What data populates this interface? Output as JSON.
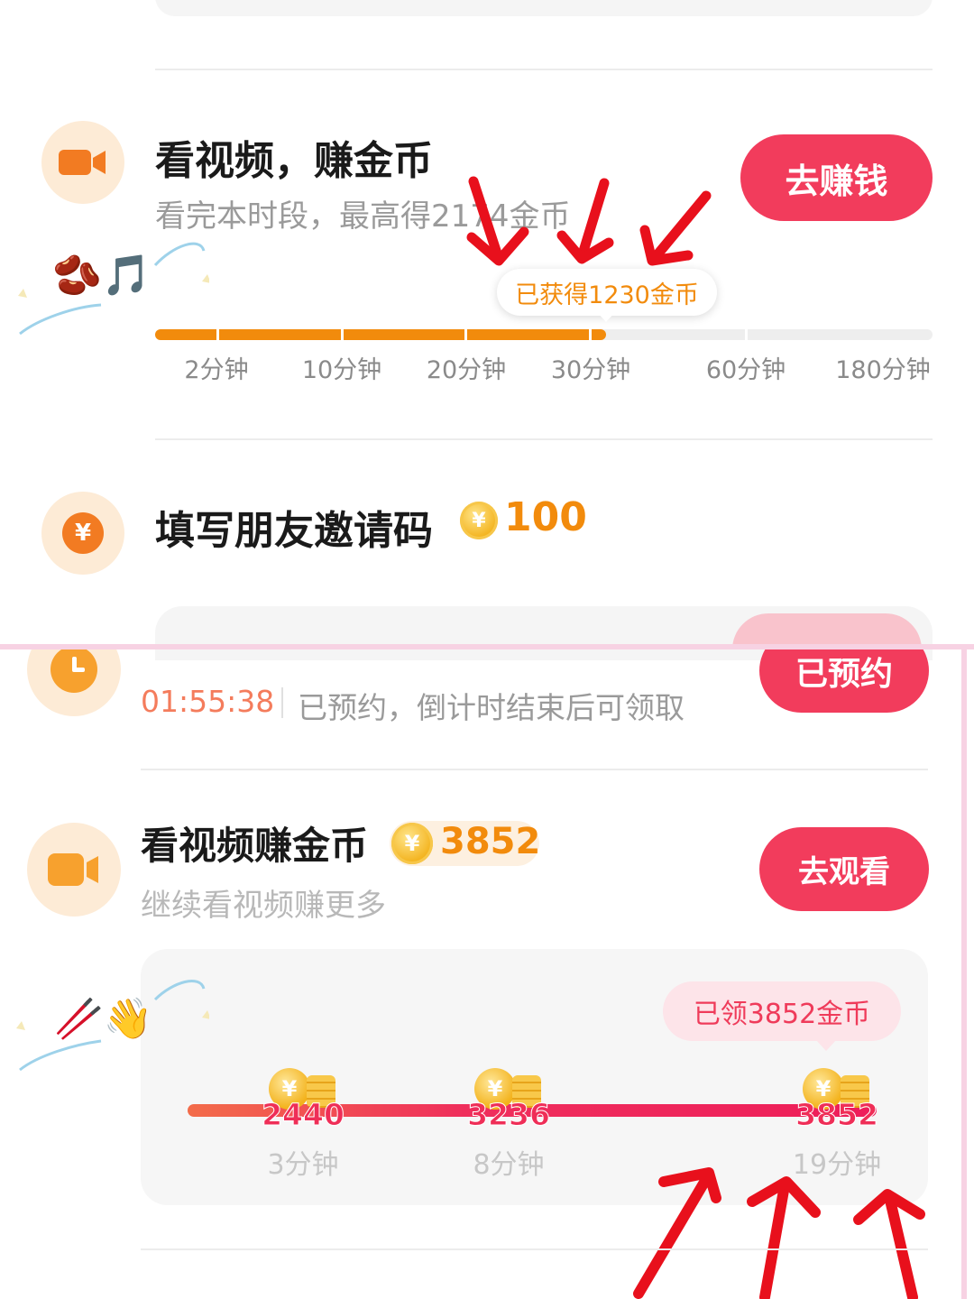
{
  "task_video_earn": {
    "title": "看视频，赚金币",
    "subtitle": "看完本时段，最高得2174金币",
    "button": "去赚钱",
    "progress_bubble": "已获得1230金币",
    "progress_fraction": 0.58,
    "ticks": [
      "2分钟",
      "10分钟",
      "20分钟",
      "30分钟",
      "60分钟",
      "180分钟"
    ],
    "icon": "video-camera-icon"
  },
  "task_invite": {
    "title": "填写朋友邀请码",
    "reward": "100",
    "coin_symbol": "¥",
    "icon": "yuan-coin-icon"
  },
  "task_reserve": {
    "countdown": "01:55:38",
    "status": "已预约，倒计时结束后可领取",
    "button": "已预约",
    "icon": "clock-icon"
  },
  "task_watch": {
    "title": "看视频赚金币",
    "reward": "3852",
    "coin_symbol": "¥",
    "subtitle": "继续看视频赚更多",
    "button": "去观看",
    "bubble": "已领3852金币",
    "milestones": [
      {
        "coins": "2440",
        "time": "3分钟"
      },
      {
        "coins": "3236",
        "time": "8分钟"
      },
      {
        "coins": "3852",
        "time": "19分钟"
      }
    ],
    "icon": "video-camera-icon"
  },
  "stickers": {
    "top": "🫘🎵",
    "bottom": "🥢👋"
  },
  "colors": {
    "accent_red": "#f23c5c",
    "accent_orange": "#f28b0c",
    "icon_bg": "#fdebd6",
    "annotation_arrow": "#e8101c",
    "frame_pink": "#f7d2e3"
  }
}
